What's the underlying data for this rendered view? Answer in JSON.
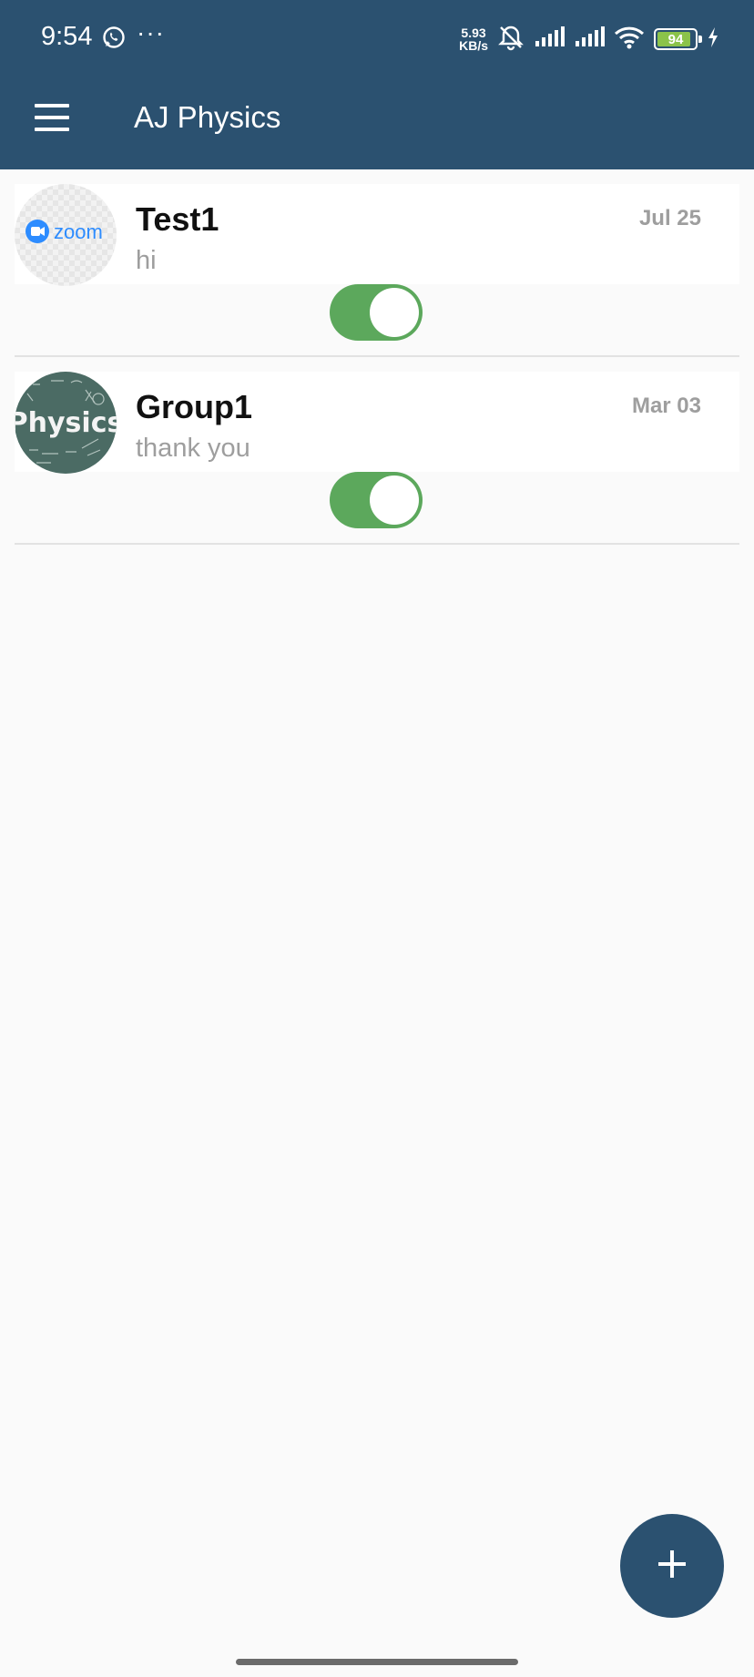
{
  "status_bar": {
    "time": "9:54",
    "more": "···",
    "net_speed_value": "5.93",
    "net_speed_unit": "KB/s",
    "battery": "94",
    "battery_level": 0.94
  },
  "app_bar": {
    "title": "AJ Physics",
    "color": "#2b5170"
  },
  "chats": [
    {
      "name": "Test1",
      "message": "hi",
      "date": "Jul 25",
      "avatar_text": "zoom",
      "toggle_on": true
    },
    {
      "name": "Group1",
      "message": "thank you",
      "date": "Mar 03",
      "avatar_text": "Physics",
      "toggle_on": true
    }
  ],
  "fab": {
    "icon": "plus-icon"
  },
  "colors": {
    "accent": "#2b5170",
    "toggle": "#5ca85c",
    "zoom_blue": "#2d8cff",
    "physics_bg": "#4b6b64"
  }
}
